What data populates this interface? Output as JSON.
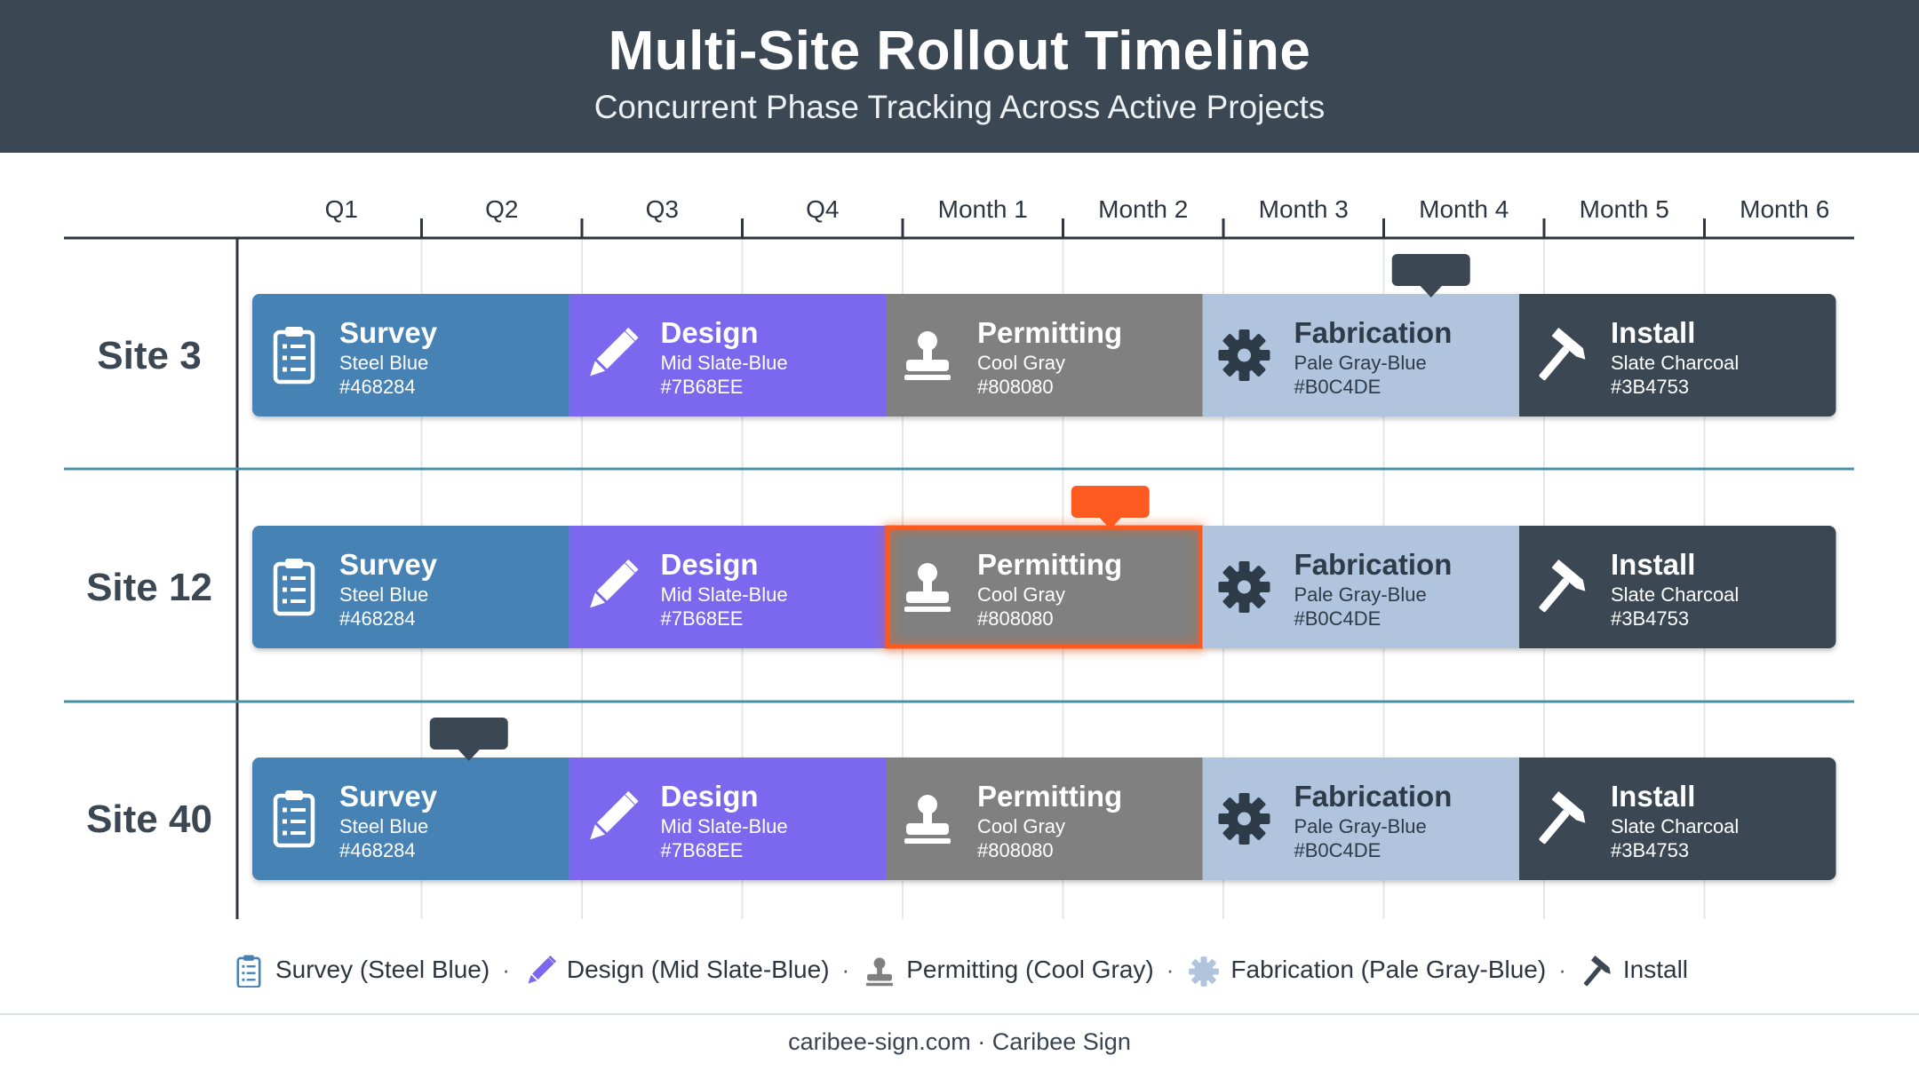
{
  "title": "Multi-Site Rollout Timeline",
  "subtitle": "Concurrent Phase Tracking Across Active Projects",
  "chart_data": {
    "type": "gantt",
    "columns": [
      "Q1",
      "Q2",
      "Q3",
      "Q4",
      "Month 1",
      "Month 2",
      "Month 3",
      "Month 4",
      "Month 5",
      "Month 6"
    ],
    "phases": [
      {
        "name": "Survey",
        "color_name": "Steel Blue",
        "hex": "#468284",
        "fill": "#4682b4",
        "text": "#ffffff",
        "icon": "clipboard-icon",
        "start": 0,
        "end": 2
      },
      {
        "name": "Design",
        "color_name": "Mid Slate-Blue",
        "hex": "#7B68EE",
        "fill": "#7b68ee",
        "text": "#ffffff",
        "icon": "pencil-icon",
        "start": 2,
        "end": 4
      },
      {
        "name": "Permitting",
        "color_name": "Cool Gray",
        "hex": "#808080",
        "fill": "#808080",
        "text": "#ffffff",
        "icon": "stamp-icon",
        "start": 4,
        "end": 6
      },
      {
        "name": "Fabrication",
        "color_name": "Pale Gray-Blue",
        "hex": "#B0C4DE",
        "fill": "#b0c4de",
        "text": "#2d3a48",
        "icon": "gear-icon",
        "start": 6,
        "end": 8
      },
      {
        "name": "Install",
        "color_name": "Slate Charcoal",
        "hex": "#3B4753",
        "fill": "#3b4753",
        "text": "#ffffff",
        "icon": "hammer-icon",
        "start": 8,
        "end": 10
      }
    ],
    "sites": [
      {
        "label": "Site 3",
        "marker_column": 7,
        "marker_style": "dark",
        "highlight_phase": null
      },
      {
        "label": "Site 12",
        "marker_column": 5,
        "marker_style": "orange",
        "highlight_phase": "Permitting"
      },
      {
        "label": "Site 40",
        "marker_column": 1,
        "marker_style": "dark",
        "highlight_phase": null
      }
    ],
    "highlight_color": "#ff5a1f",
    "marker_dark_color": "#3b4753"
  },
  "legend": [
    {
      "label": "Survey (Steel Blue)",
      "icon": "clipboard-icon",
      "color": "#4682b4"
    },
    {
      "label": "Design (Mid Slate-Blue)",
      "icon": "pencil-icon",
      "color": "#7b68ee"
    },
    {
      "label": "Permitting (Cool Gray)",
      "icon": "stamp-icon",
      "color": "#808080"
    },
    {
      "label": "Fabrication (Pale Gray-Blue)",
      "icon": "gear-icon",
      "color": "#b0c4de"
    },
    {
      "label": "Install",
      "icon": "hammer-icon",
      "color": "#3b4753"
    }
  ],
  "legend_separator": "·",
  "footer": "caribee-sign.com · Caribee Sign"
}
